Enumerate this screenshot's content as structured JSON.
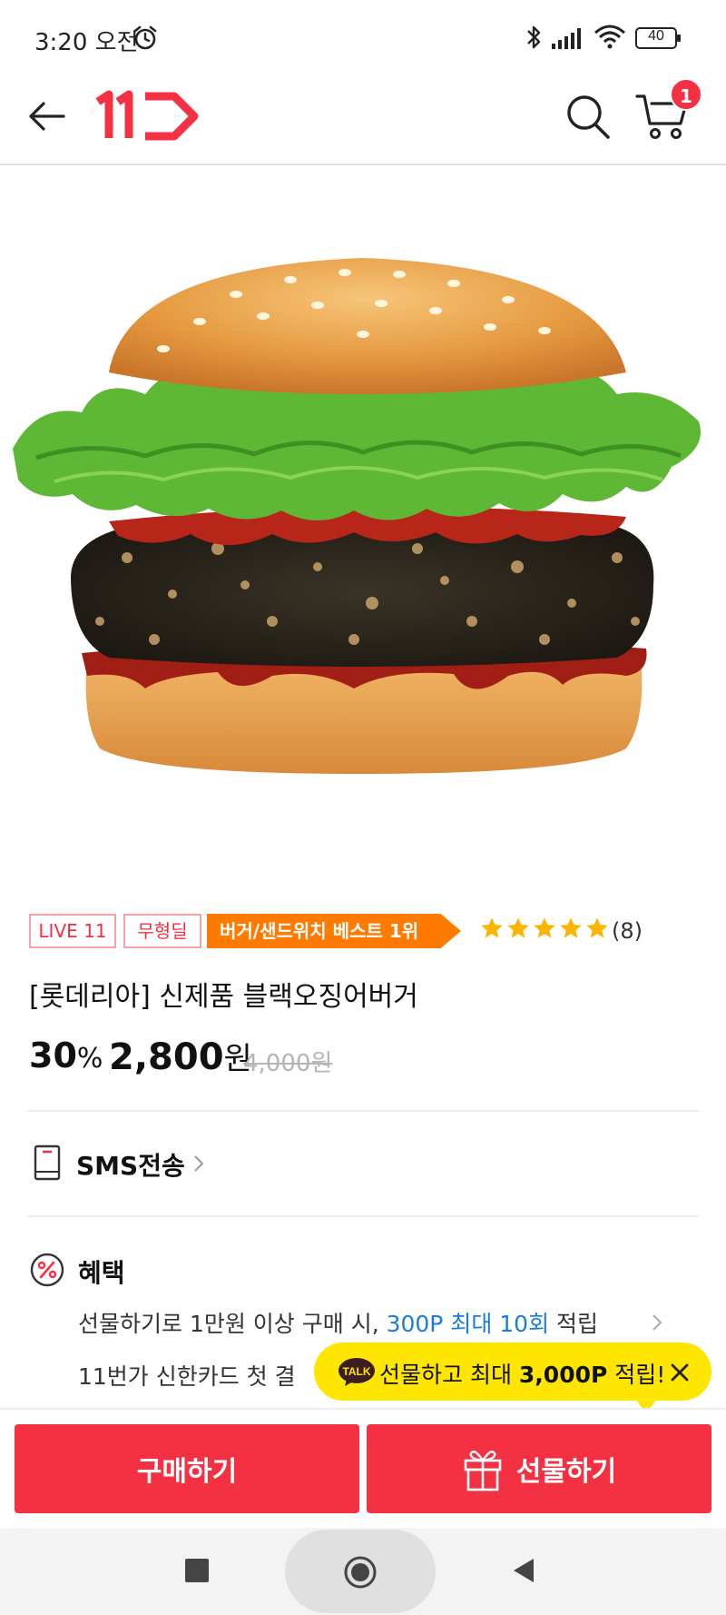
{
  "status_bar": {
    "time": "3:20 오전",
    "battery": "40"
  },
  "header": {
    "cart_count": "1"
  },
  "product": {
    "tags": {
      "live": "LIVE 11",
      "no_shape": "무형딜",
      "best": "버거/샌드위치 베스트 1위"
    },
    "rating_stars": 5,
    "review_count": "(8)",
    "title": "[롯데리아] 신제품 블랙오징어버거",
    "discount_value": "30",
    "discount_unit": "%",
    "price_value": "2,800",
    "price_unit": "원",
    "original_price": "4,000원"
  },
  "sms": {
    "label": "SMS전송"
  },
  "benefit": {
    "label": "혜택",
    "line1_prefix": "선물하기로 1만원 이상 구매 시, ",
    "line1_highlight": "300P 최대 10회",
    "line1_suffix": " 적립",
    "line2": "11번가 신한카드 첫 결"
  },
  "talk_tooltip": {
    "badge": "TALK",
    "text_prefix": "선물하고 최대 ",
    "text_bold": "3,000P",
    "text_suffix": " 적립!"
  },
  "actions": {
    "buy_label": "구매하기",
    "gift_label": "선물하기"
  },
  "colors": {
    "brand_red": "#f43142",
    "best_orange": "#ff7a00",
    "star_yellow": "#f9b500",
    "link_blue": "#1a7dd7",
    "kakao_yellow": "#ffe600"
  }
}
